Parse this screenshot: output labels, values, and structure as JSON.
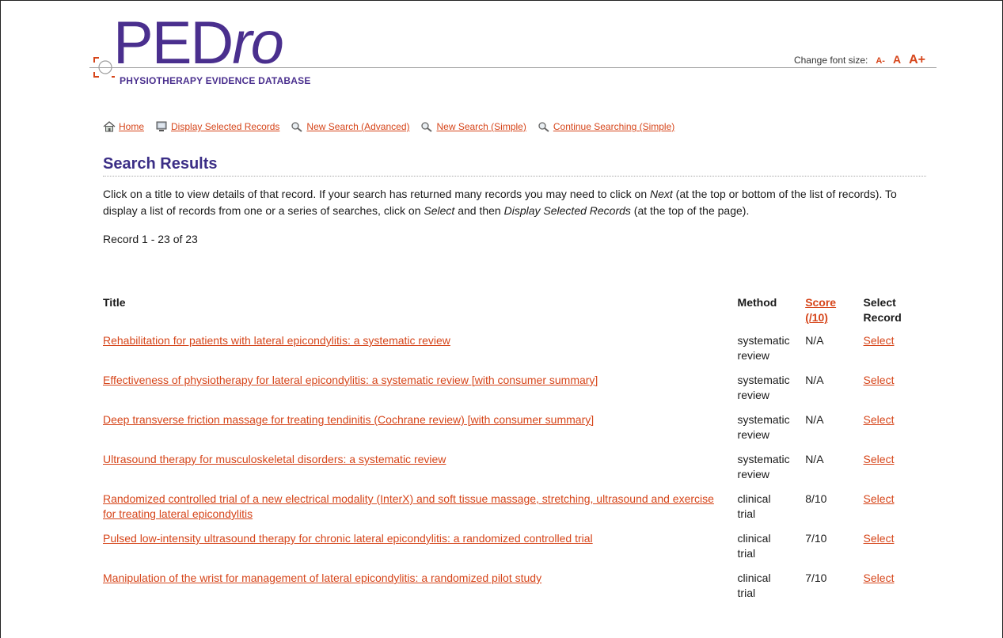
{
  "header": {
    "logo_main": "PED",
    "logo_italic": "ro",
    "logo_subtitle": "PHYSIOTHERAPY EVIDENCE DATABASE",
    "font_size_label": "Change font size:",
    "font_size_options": [
      "A-",
      "A",
      "A+"
    ]
  },
  "nav": {
    "items": [
      {
        "label": "Home",
        "icon": "home-icon"
      },
      {
        "label": "Display Selected Records",
        "icon": "monitor-icon"
      },
      {
        "label": "New Search (Advanced)",
        "icon": "magnifier-icon"
      },
      {
        "label": "New Search (Simple)",
        "icon": "magnifier-icon"
      },
      {
        "label": "Continue Searching (Simple)",
        "icon": "magnifier-icon"
      }
    ]
  },
  "main": {
    "title": "Search Results",
    "intro": {
      "part1": "Click on a title to view details of that record. If your search has returned many records you may need to click on ",
      "next": "Next",
      "part2": " (at the top or bottom of the list of records). To display a list of records from one or a series of searches, click on ",
      "select": "Select",
      "part3": " and then ",
      "display": "Display Selected Records",
      "part4": " (at the top of the page)."
    },
    "record_count": "Record 1 - 23 of 23"
  },
  "table": {
    "headers": {
      "title": "Title",
      "method": "Method",
      "score_line1": "Score",
      "score_line2": "(/10)",
      "select_line1": "Select",
      "select_line2": "Record"
    },
    "rows": [
      {
        "title": "Rehabilitation for patients with lateral epicondylitis: a systematic review",
        "method_line1": "systematic",
        "method_line2": "review",
        "score": "N/A",
        "select": "Select"
      },
      {
        "title": "Effectiveness of physiotherapy for lateral epicondylitis: a systematic review [with consumer summary]",
        "method_line1": "systematic",
        "method_line2": "review",
        "score": "N/A",
        "select": "Select"
      },
      {
        "title": "Deep transverse friction massage for treating tendinitis (Cochrane review) [with consumer summary]",
        "method_line1": "systematic",
        "method_line2": "review",
        "score": "N/A",
        "select": "Select"
      },
      {
        "title": "Ultrasound therapy for musculoskeletal disorders: a systematic review",
        "method_line1": "systematic",
        "method_line2": "review",
        "score": "N/A",
        "select": "Select"
      },
      {
        "title": "Randomized controlled trial of a new electrical modality (InterX) and soft tissue massage, stretching, ultrasound and exercise for treating lateral epicondylitis",
        "method_line1": "clinical",
        "method_line2": "trial",
        "score": "8/10",
        "select": "Select"
      },
      {
        "title": "Pulsed low-intensity ultrasound therapy for chronic lateral epicondylitis: a randomized controlled trial",
        "method_line1": "clinical",
        "method_line2": "trial",
        "score": "7/10",
        "select": "Select"
      },
      {
        "title": "Manipulation of the wrist for management of lateral epicondylitis: a randomized pilot study",
        "method_line1": "clinical",
        "method_line2": "trial",
        "score": "7/10",
        "select": "Select"
      }
    ]
  },
  "colors": {
    "brand_purple": "#4a2f8e",
    "link_orange": "#d6451a",
    "title_navy": "#3b2e86"
  }
}
